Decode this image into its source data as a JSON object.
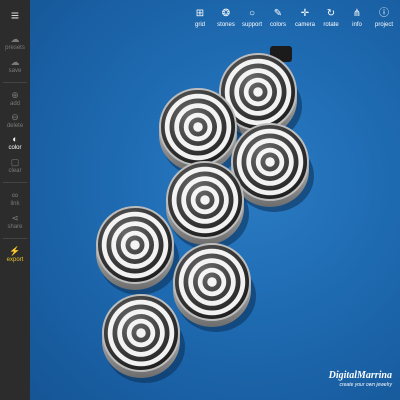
{
  "sidebar": {
    "items": [
      {
        "label": "presets",
        "icon": "cloud-icon"
      },
      {
        "label": "save",
        "icon": "cloud-upload-icon"
      },
      {
        "label": "add",
        "icon": "add-circle-icon"
      },
      {
        "label": "delete",
        "icon": "remove-circle-icon"
      },
      {
        "label": "color",
        "icon": "half-circle-icon"
      },
      {
        "label": "clear",
        "icon": "clear-icon"
      },
      {
        "label": "link",
        "icon": "link-icon"
      },
      {
        "label": "share",
        "icon": "share-icon"
      },
      {
        "label": "export",
        "icon": "lightning-icon"
      }
    ]
  },
  "toolbar": {
    "items": [
      {
        "label": "grid",
        "icon": "grid-icon"
      },
      {
        "label": "stones",
        "icon": "stones-icon"
      },
      {
        "label": "support",
        "icon": "ring-icon"
      },
      {
        "label": "colors",
        "icon": "brush-icon"
      },
      {
        "label": "camera",
        "icon": "camera-icon"
      },
      {
        "label": "rotate",
        "icon": "rotate-icon"
      },
      {
        "label": "info",
        "icon": "hierarchy-icon"
      },
      {
        "label": "project",
        "icon": "info-icon"
      }
    ]
  },
  "brand": {
    "name": "DigitalMarrina",
    "tagline": "create your own jewelry"
  },
  "colors": {
    "background": "#1f6cb3",
    "sidebar": "#2c2c2c",
    "export_accent": "#e6c229"
  }
}
